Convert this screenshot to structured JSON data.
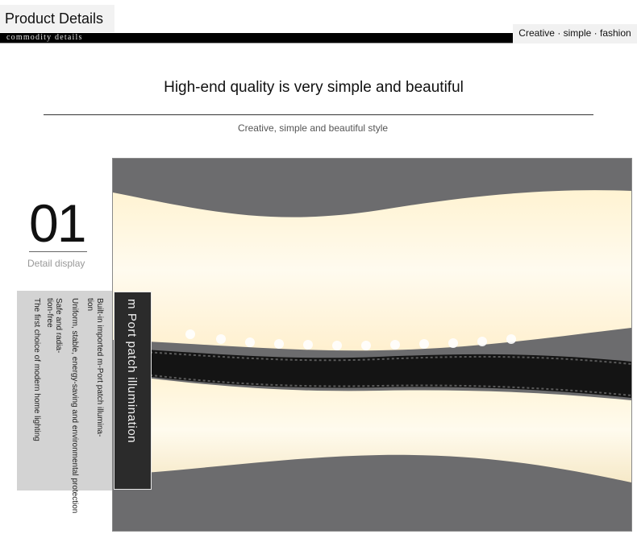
{
  "header": {
    "title": "Product Details",
    "subtitle": "commodity details",
    "tagline": "Creative · simple · fashion"
  },
  "hero": {
    "headline": "High-end quality is very simple and beautiful",
    "subline": "Creative, simple and beautiful style"
  },
  "section": {
    "number": "01",
    "label": "Detail display",
    "feature_title": "m Port patch illumination",
    "features": [
      "Built-in imported m-Port patch illumina-",
      "tion",
      "Uniform, stable, energy-saving and environmental protection",
      "Safe and radia-",
      "tion-free",
      "The first choice of modern home lighting"
    ]
  },
  "colors": {
    "black": "#000000",
    "panel_gray": "#d3d3d3",
    "panel_dark": "#2b2b2b",
    "photo_bg": "#6c6c6e",
    "glow": "#fff6dc"
  }
}
